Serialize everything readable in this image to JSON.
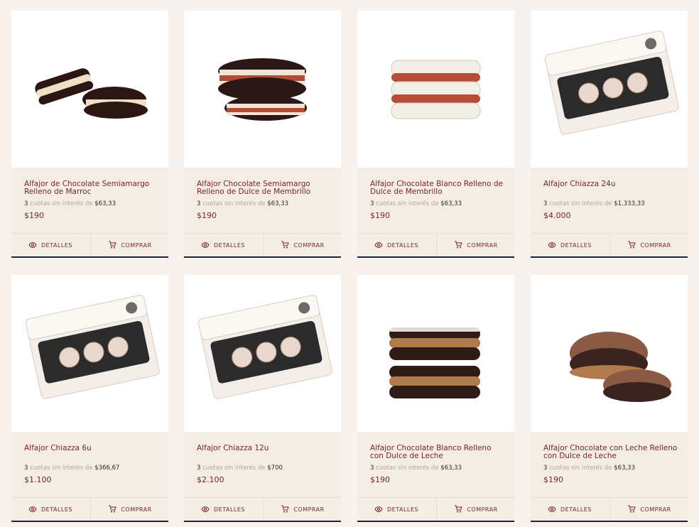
{
  "labels": {
    "details": "DETALLES",
    "buy": "COMPRAR",
    "installments_text": "cuotas sin interés de"
  },
  "colors": {
    "page_bg": "#f7f2ee",
    "info_bg": "#f4ede6",
    "title": "#7a2424",
    "accent_line": "#1d2540"
  },
  "products": [
    {
      "name": "Alfajor de Chocolate Semiamargo Relleno de Marroc",
      "installments": "3",
      "installment_amount": "$63,33",
      "price": "$190",
      "image": "semiamargo-marroc"
    },
    {
      "name": "Alfajor Chocolate Semiamargo Relleno de Dulce de Membrillo",
      "installments": "3",
      "installment_amount": "$63,33",
      "price": "$190",
      "image": "semiamargo-membrillo"
    },
    {
      "name": "Alfajor Chocolate Blanco Relleno de Dulce de Membrillo",
      "installments": "3",
      "installment_amount": "$63,33",
      "price": "$190",
      "image": "blanco-membrillo"
    },
    {
      "name": "Alfajor Chiazza 24u",
      "installments": "3",
      "installment_amount": "$1.333,33",
      "price": "$4.000",
      "image": "box"
    },
    {
      "name": "Alfajor Chiazza 6u",
      "installments": "3",
      "installment_amount": "$366,67",
      "price": "$1.100",
      "image": "box"
    },
    {
      "name": "Alfajor Chiazza 12u",
      "installments": "3",
      "installment_amount": "$700",
      "price": "$2.100",
      "image": "box"
    },
    {
      "name": "Alfajor Chocolate Blanco Relleno con Dulce de Leche",
      "installments": "3",
      "installment_amount": "$63,33",
      "price": "$190",
      "image": "blanco-dulce-leche"
    },
    {
      "name": "Alfajor Chocolate con Leche Relleno con Dulce de Leche",
      "installments": "3",
      "installment_amount": "$63,33",
      "price": "$190",
      "image": "leche-dulce-leche"
    }
  ]
}
